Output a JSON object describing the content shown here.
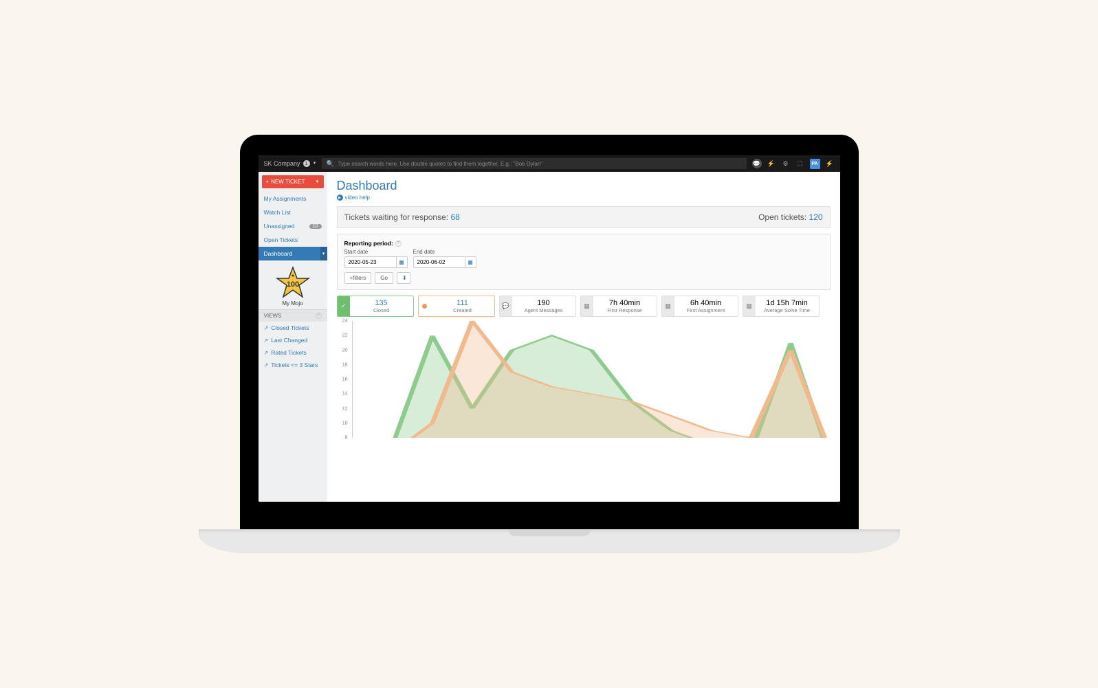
{
  "topbar": {
    "company_name": "SK Company",
    "notification_count": "1",
    "search_placeholder": "Type search words here. Use double quotes to find them together. E.g.: \"Bob Dylan\"",
    "avatar_initials": "PA"
  },
  "sidebar": {
    "new_ticket_label": "NEW TICKET",
    "items": [
      {
        "label": "My Assignments"
      },
      {
        "label": "Watch List"
      },
      {
        "label": "Unassigned",
        "badge": "10"
      },
      {
        "label": "Open Tickets"
      },
      {
        "label": "Dashboard",
        "active": true
      }
    ],
    "mojo_value": "100",
    "mojo_label": "My Mojo",
    "views_header": "VIEWS",
    "views": [
      {
        "label": "Closed Tickets"
      },
      {
        "label": "Last Changed"
      },
      {
        "label": "Rated Tickets"
      },
      {
        "label": "Tickets <= 3 Stars"
      }
    ]
  },
  "page": {
    "title": "Dashboard",
    "video_help": "video help",
    "waiting_label": "Tickets waiting for response: ",
    "waiting_value": "68",
    "open_label": "Open tickets: ",
    "open_value": "120"
  },
  "report": {
    "period_label": "Reporting period:",
    "start_label": "Start date",
    "end_label": "End date",
    "start_value": "2020-05-23",
    "end_value": "2020-06-02",
    "filters_btn": "+filters",
    "go_btn": "Go"
  },
  "cards": [
    {
      "value": "135",
      "label": "Closed",
      "style": "green",
      "icon": "check"
    },
    {
      "value": "111",
      "label": "Created",
      "style": "orange",
      "icon": "dot"
    },
    {
      "value": "190",
      "label": "Agent Messages",
      "style": "gray",
      "icon": "chat"
    },
    {
      "value": "7h 40min",
      "label": "First Response",
      "style": "gray",
      "icon": "cal"
    },
    {
      "value": "6h 40min",
      "label": "First Assignment",
      "style": "gray",
      "icon": "cal"
    },
    {
      "value": "1d 15h 7min",
      "label": "Average Solve Time",
      "style": "gray",
      "icon": "cal"
    }
  ],
  "chart_data": {
    "type": "area",
    "ylim": [
      8,
      24
    ],
    "yticks": [
      8,
      10,
      12,
      14,
      16,
      18,
      20,
      22,
      24
    ],
    "x": [
      0,
      1,
      2,
      3,
      4,
      5,
      6,
      7,
      8,
      9,
      10,
      11,
      12
    ],
    "series": [
      {
        "name": "Closed",
        "color": "#8fcb8f",
        "values": [
          3,
          7,
          22,
          12,
          20,
          22,
          20,
          13,
          9,
          7,
          6,
          21,
          5
        ]
      },
      {
        "name": "Created",
        "color": "#f0b98e",
        "values": [
          2,
          6,
          10,
          24,
          17,
          15,
          14,
          13,
          11,
          9,
          8,
          20,
          6
        ]
      }
    ]
  }
}
